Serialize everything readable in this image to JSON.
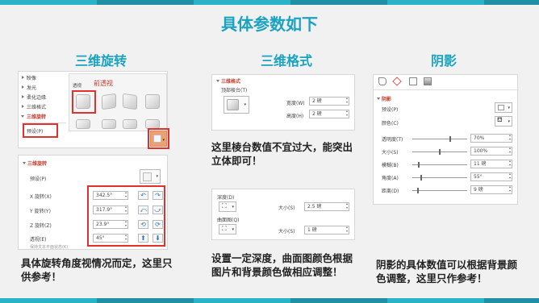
{
  "title": "具体参数如下",
  "col1": {
    "heading": "三维旋转",
    "top_panel": {
      "menu": [
        "映像",
        "发光",
        "柔化边缘",
        "三维格式",
        "三维旋转"
      ],
      "preset_label": "预设(P)",
      "gallery_small_label": "透视",
      "gallery_red_label": "前透视"
    },
    "bottom_panel": {
      "section": "三维旋转",
      "preset": "预设(P)",
      "rows": [
        {
          "label": "X 旋转(X)",
          "value": "342.5°"
        },
        {
          "label": "Y 旋转(Y)",
          "value": "317.9°"
        },
        {
          "label": "Z 旋转(Z)",
          "value": "23.9°"
        },
        {
          "label": "透视(E)",
          "value": "45°"
        }
      ],
      "keep_flat": "保持文本平面状态(K)"
    },
    "caption": "具体旋转角度视情况而定，这里只供参考！"
  },
  "col2": {
    "heading": "三维格式",
    "panel1": {
      "section": "三维格式",
      "bevel_label": "顶部棱台(T)",
      "width_label": "宽度(W)",
      "width_value": "2 磅",
      "height_label": "高度(H)",
      "height_value": "2 磅"
    },
    "note1": "这里棱台数值不宜过大，能突出立体即可！",
    "panel2": {
      "depth_label": "深度(D)",
      "depth_size_label": "大小(S)",
      "depth_size_value": "2.5 磅",
      "contour_label": "曲面图(Q)",
      "contour_size_label": "大小(S)",
      "contour_size_value": "1 磅"
    },
    "caption": "设置一定深度，曲面图颜色根据图片和背景颜色做相应调整！"
  },
  "col3": {
    "heading": "阴影",
    "panel": {
      "section": "阴影",
      "preset": "预设(P)",
      "color": "颜色(C)",
      "rows": [
        {
          "label": "透明度(T)",
          "value": "70%",
          "level": 0.7
        },
        {
          "label": "大小(S)",
          "value": "100%",
          "level": 0.5
        },
        {
          "label": "模糊(B)",
          "value": "11 磅",
          "level": 0.11
        },
        {
          "label": "角度(A)",
          "value": "55°",
          "level": 0.15
        },
        {
          "label": "距离(D)",
          "value": "9 磅",
          "level": 0.09
        }
      ]
    },
    "caption": "阴影的具体数值可以根据背景颜色调整，这里只作参考！"
  },
  "colors": {
    "accent": "#1aa3c0",
    "highlight": "#e03131",
    "orange": "#f0a070"
  }
}
